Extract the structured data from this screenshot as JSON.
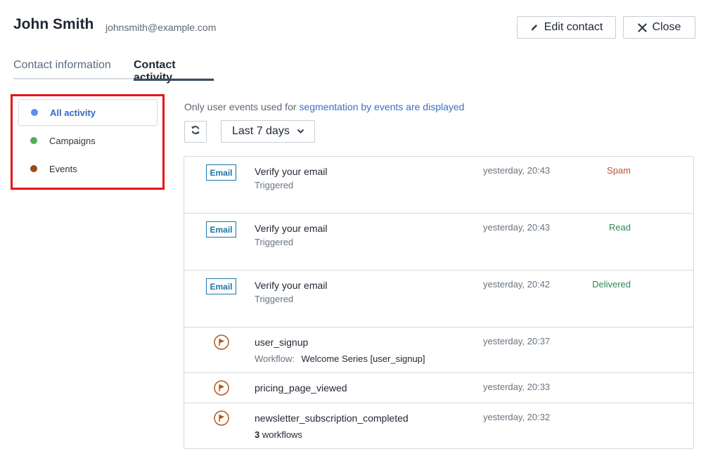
{
  "header": {
    "name": "John Smith",
    "email": "johnsmith@example.com",
    "edit_label": "Edit contact",
    "close_label": "Close"
  },
  "tabs": [
    {
      "label": "Contact information",
      "active": false
    },
    {
      "label": "Contact activity",
      "active": true
    }
  ],
  "filters": [
    {
      "label": "All activity",
      "color": "#5b8def",
      "active": true
    },
    {
      "label": "Campaigns",
      "color": "#4fae5f",
      "active": false
    },
    {
      "label": "Events",
      "color": "#9a4b12",
      "active": false
    }
  ],
  "notice": {
    "prefix": "Only user events used for",
    "link": "segmentation by events are displayed"
  },
  "range_select": {
    "value": "Last 7 days"
  },
  "activity": [
    {
      "type": "email",
      "badge": "Email",
      "title": "Verify your email",
      "subtitle": "Triggered",
      "time": "yesterday, 20:43",
      "status": "Spam",
      "status_color": "#c0513a"
    },
    {
      "type": "email",
      "badge": "Email",
      "title": "Verify your email",
      "subtitle": "Triggered",
      "time": "yesterday, 20:43",
      "status": "Read",
      "status_color": "#2e8a53"
    },
    {
      "type": "email",
      "badge": "Email",
      "title": "Verify your email",
      "subtitle": "Triggered",
      "time": "yesterday, 20:42",
      "status": "Delivered",
      "status_color": "#2e8a53"
    },
    {
      "type": "event",
      "title": "user_signup",
      "workflow_label": "Workflow:",
      "workflow_name": "Welcome Series [user_signup]",
      "time": "yesterday, 20:37"
    },
    {
      "type": "event",
      "title": "pricing_page_viewed",
      "time": "yesterday, 20:33"
    },
    {
      "type": "event",
      "title": "newsletter_subscription_completed",
      "workflow_count": "3",
      "workflow_count_suffix": "workflows",
      "time": "yesterday, 20:32"
    }
  ],
  "colors": {
    "accent": "#3a6fc0",
    "highlight_border": "#e8141c",
    "event_icon": "#b1591c"
  },
  "icons": [
    "pencil-icon",
    "close-icon",
    "refresh-icon",
    "chevron-down-icon",
    "flag-icon"
  ]
}
